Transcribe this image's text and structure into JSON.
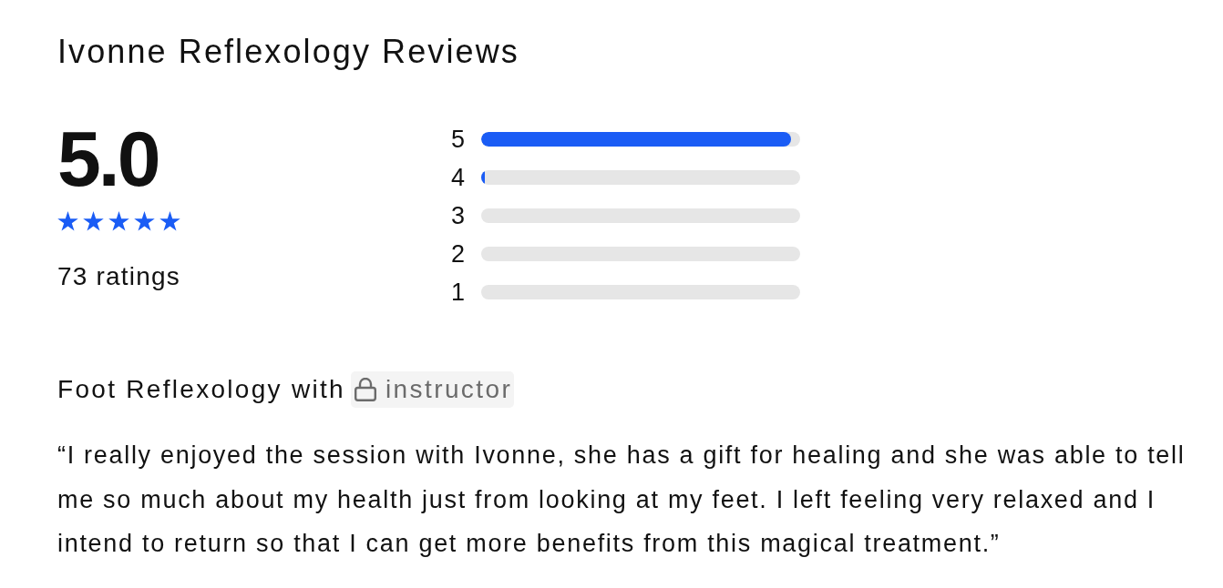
{
  "title": "Ivonne Reflexology Reviews",
  "summary": {
    "average": "5.0",
    "stars": 5,
    "count": "73 ratings"
  },
  "distribution": [
    {
      "label": "5",
      "level": 0.97
    },
    {
      "label": "4",
      "level": 0.01
    },
    {
      "label": "3",
      "level": 0
    },
    {
      "label": "2",
      "level": 0
    },
    {
      "label": "1",
      "level": 0
    }
  ],
  "review": {
    "service": "Foot Reflexology with",
    "instructor": "instructor",
    "quote": "“I really enjoyed the session with Ivonne, she has a gift for healing and she was able to tell me so much about my health just from looking at my feet. I left feeling very relaxed and I intend to return so that I can get more benefits from this magical treatment.”"
  }
}
